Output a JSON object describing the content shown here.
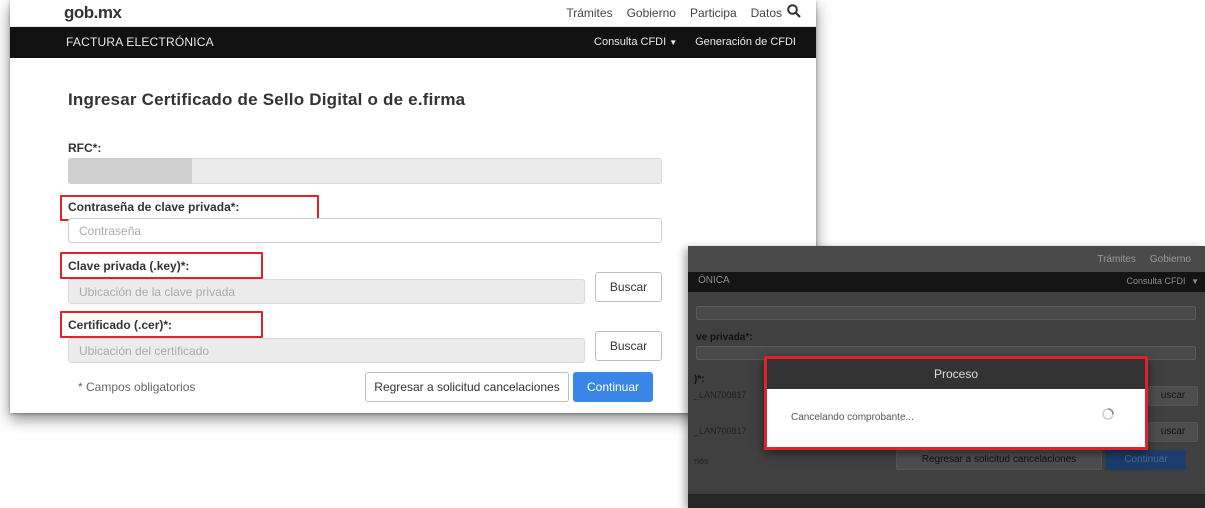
{
  "main": {
    "logo": {
      "left": "gob",
      "right": "mx"
    },
    "topnav": [
      "Trámites",
      "Gobierno",
      "Participa",
      "Datos"
    ],
    "section_title": "FACTURA ELECTRÓNICA",
    "menu": {
      "consulta": "Consulta CFDI",
      "generacion": "Generación de CFDI"
    },
    "form_title": "Ingresar Certificado de Sello Digital o de e.firma",
    "rfc_label": "RFC*:",
    "password_label": "Contraseña de clave privada*:",
    "password_placeholder": "Contraseña",
    "key_label": "Clave privada (.key)*:",
    "key_placeholder": "Ubicación de la clave privada",
    "cer_label": "Certificado (.cer)*:",
    "cer_placeholder": "Ubicación del certificado",
    "browse_label": "Buscar",
    "required_note": "* Campos obligatorios",
    "back_button": "Regresar a solicitud cancelaciones",
    "continue_button": "Continuar"
  },
  "popup": {
    "topnav": [
      "Trámites",
      "Gobierno"
    ],
    "section_title": "ÓNICA",
    "menu_consulta": "Consulta CFDI",
    "password_label": "ve privada*:",
    "key_label": ")*:",
    "key_value": "_LAN700817",
    "cer_value": "_LAN700817",
    "browse_label": "uscar",
    "required_note": "rios",
    "back_button": "Regresar a solicitud cancelaciones",
    "continue_button": "Continuar",
    "modal_title": "Proceso",
    "modal_message": "Cancelando comprobante..."
  },
  "colors": {
    "highlight": "#e0232a",
    "primary": "#3a86e6",
    "bar": "#111111"
  }
}
